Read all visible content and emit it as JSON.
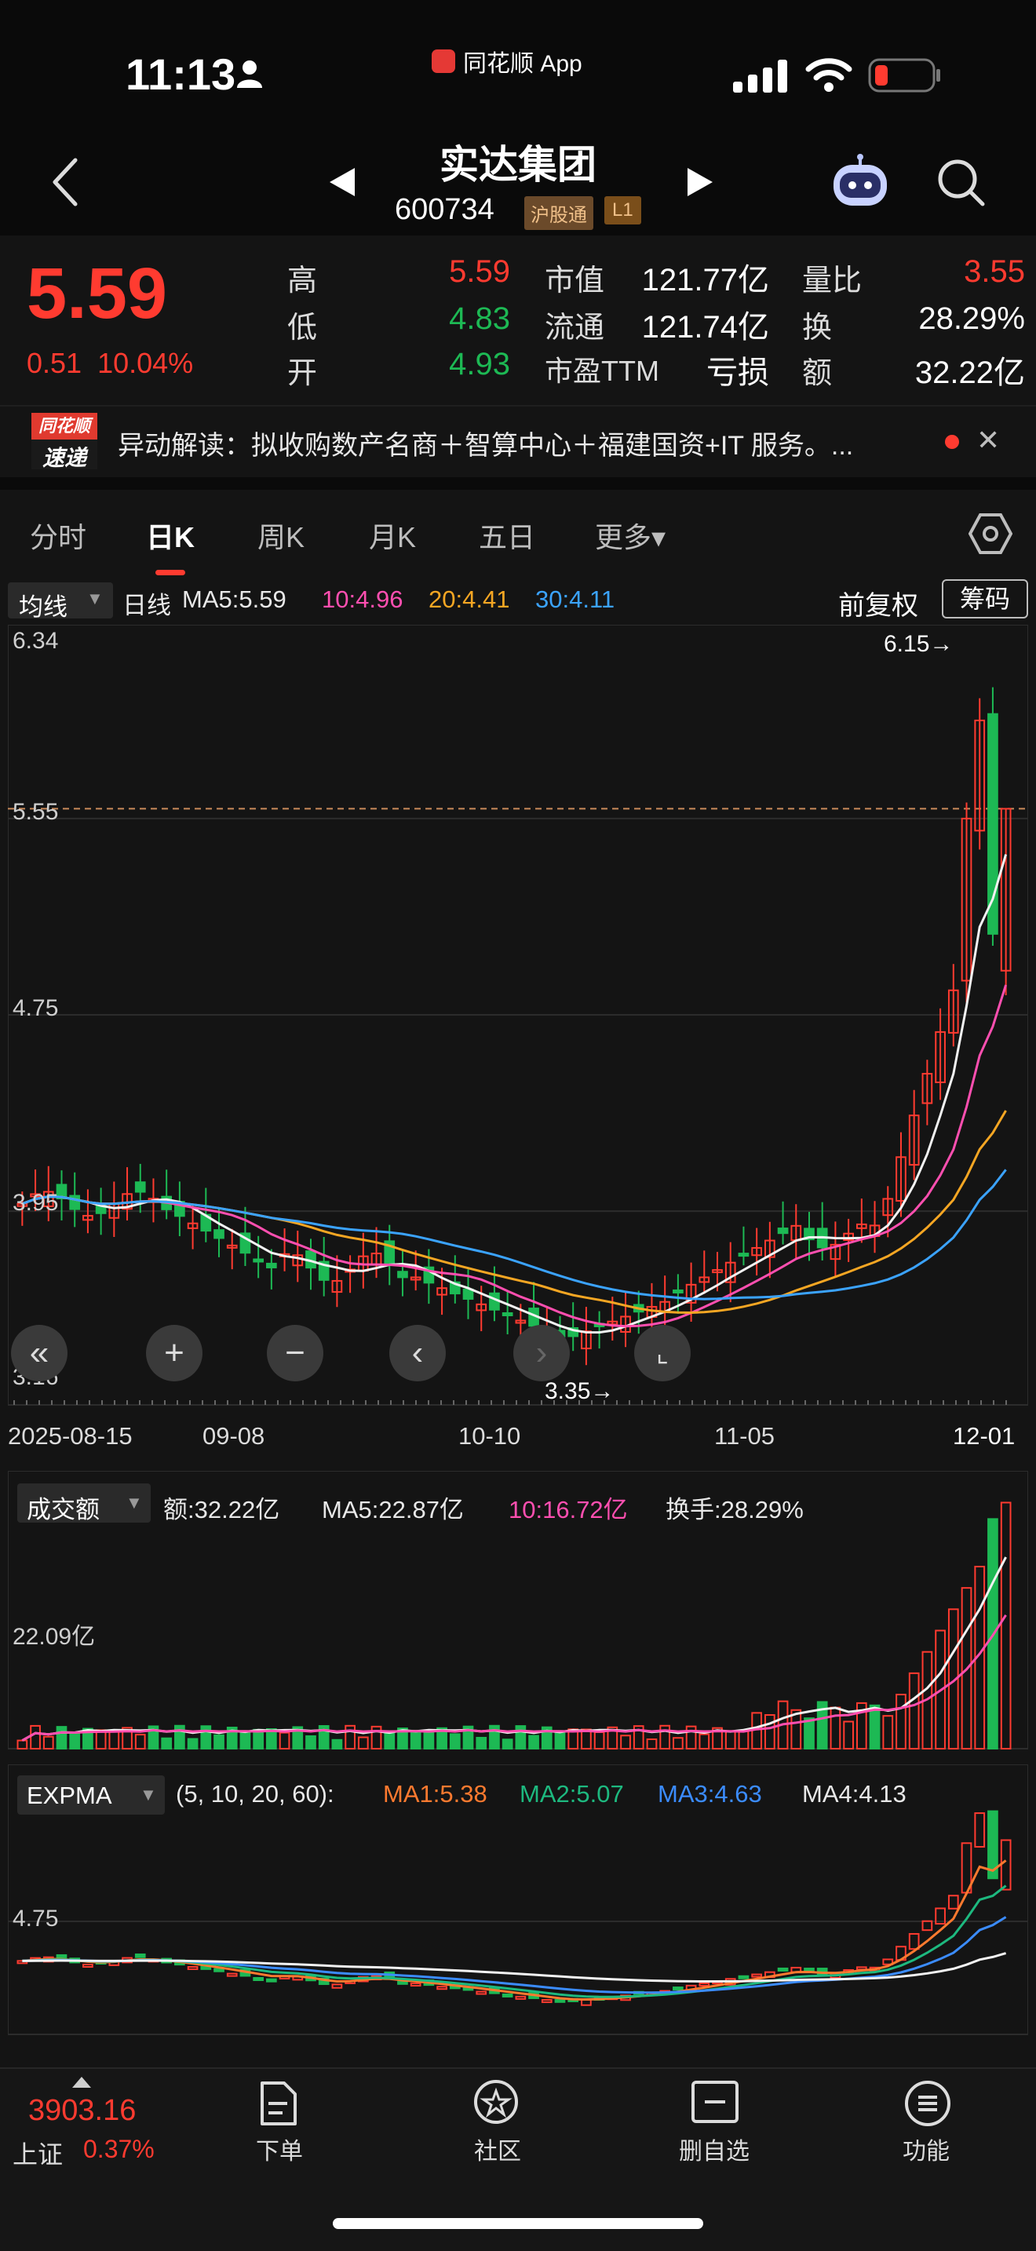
{
  "status_bar": {
    "time": "11:13",
    "app_label": "同花顺 App"
  },
  "header": {
    "stock_name": "实达集团",
    "stock_code": "600734",
    "tag_hgt": "沪股通",
    "tag_l1": "L1"
  },
  "quote": {
    "price": "5.59",
    "change_abs": "0.51",
    "change_pct": "10.04%",
    "rows": [
      {
        "l1": "高",
        "v1": "5.59",
        "c1": "red",
        "l2": "市值",
        "v2": "121.77亿",
        "l3": "量比",
        "v3": "3.55",
        "c3": "red"
      },
      {
        "l1": "低",
        "v1": "4.83",
        "c1": "green",
        "l2": "流通",
        "v2": "121.74亿",
        "l3": "换",
        "v3": "28.29%",
        "c3": "white"
      },
      {
        "l1": "开",
        "v1": "4.93",
        "c1": "green",
        "l2": "市盈TTM",
        "v2": "亏损",
        "l3": "额",
        "v3": "32.22亿",
        "c3": "white"
      }
    ]
  },
  "news": {
    "logo_top": "同花顺",
    "logo_bottom": "速递",
    "text": "异动解读：拟收购数产名商＋智算中心＋福建国资+IT 服务。..."
  },
  "tabs": [
    {
      "label": "分时",
      "active": false
    },
    {
      "label": "日K",
      "active": true
    },
    {
      "label": "周K",
      "active": false
    },
    {
      "label": "月K",
      "active": false
    },
    {
      "label": "五日",
      "active": false
    },
    {
      "label": "更多▾",
      "active": false
    }
  ],
  "ma_legend": {
    "dropdown": "均线",
    "period": "日线",
    "items": [
      {
        "text": "MA5:5.59",
        "color": "#e8e8e8"
      },
      {
        "text": "10:4.96",
        "color": "#ff4fb0"
      },
      {
        "text": "20:4.41",
        "color": "#f5a623"
      },
      {
        "text": "30:4.11",
        "color": "#3ba3ff"
      }
    ],
    "fuquan": "前复权",
    "chouma": "筹码"
  },
  "kchart": {
    "y_labels": [
      "6.34",
      "5.55",
      "4.75",
      "3.95",
      "3.16"
    ],
    "high_marker": "6.15→",
    "low_marker": "3.35→",
    "dates": [
      "2025-08-15",
      "09-08",
      "10-10",
      "11-05",
      "12-01"
    ]
  },
  "volume": {
    "dropdown": "成交额",
    "items": [
      {
        "text": "额:32.22亿",
        "color": "#e8e8e8"
      },
      {
        "text": "MA5:22.87亿",
        "color": "#e8e8e8"
      },
      {
        "text": "10:16.72亿",
        "color": "#ff4fb0"
      },
      {
        "text": "换手:28.29%",
        "color": "#e8e8e8"
      }
    ],
    "y_label": "22.09亿"
  },
  "expma": {
    "dropdown": "EXPMA",
    "items": [
      {
        "text": "(5, 10, 20, 60):",
        "color": "#e8e8e8"
      },
      {
        "text": "MA1:5.38",
        "color": "#ff7a2f"
      },
      {
        "text": "MA2:5.07",
        "color": "#1db97f"
      },
      {
        "text": "MA3:4.63",
        "color": "#3b8cff"
      },
      {
        "text": "MA4:4.13",
        "color": "#e8e8e8"
      }
    ],
    "y_label": "4.75"
  },
  "bottom": {
    "index_value": "3903.16",
    "index_name": "上证",
    "index_pct": "0.37%",
    "nav": [
      {
        "label": "下单",
        "icon": "order-doc-icon"
      },
      {
        "label": "社区",
        "icon": "community-star-icon"
      },
      {
        "label": "删自选",
        "icon": "remove-watchlist-icon"
      },
      {
        "label": "功能",
        "icon": "menu-list-icon"
      }
    ]
  },
  "chart_data": {
    "type": "candlestick",
    "y_range_price": [
      3.16,
      6.34
    ],
    "period_high": 6.15,
    "period_low": 3.35,
    "last_close": 5.59,
    "last_day": {
      "open": 4.93,
      "high": 5.59,
      "low": 4.83,
      "close": 5.59
    },
    "ma": {
      "MA5": 5.59,
      "MA10": 4.96,
      "MA20": 4.41,
      "MA30": 4.11
    },
    "expma": {
      "MA1": 5.38,
      "MA2": 5.07,
      "MA3": 4.63,
      "MA4": 4.13
    },
    "turnover_today": "32.22亿",
    "turnover_ma5": "22.87亿",
    "turnover_ma10": "16.72亿"
  }
}
